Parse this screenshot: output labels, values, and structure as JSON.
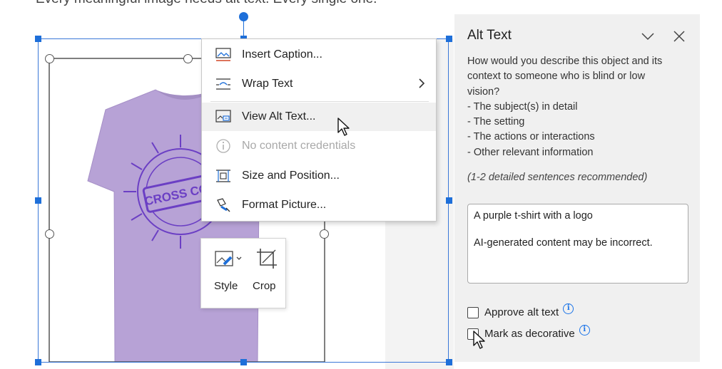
{
  "document": {
    "caption_text": "Every meaningful image needs alt text. Every single one.",
    "image_logo_text": "CROSS COU"
  },
  "context_menu": {
    "items": [
      {
        "label": "Insert Caption...",
        "icon": "insert-caption-icon",
        "state": "normal"
      },
      {
        "label": "Wrap Text",
        "icon": "wrap-text-icon",
        "state": "normal",
        "has_submenu": true
      },
      {
        "label": "View Alt Text...",
        "icon": "alt-text-icon",
        "state": "hover"
      },
      {
        "label": "No content credentials",
        "icon": "info-icon",
        "state": "disabled"
      },
      {
        "label": "Size and Position...",
        "icon": "size-position-icon",
        "state": "normal"
      },
      {
        "label": "Format Picture...",
        "icon": "format-picture-icon",
        "state": "normal"
      }
    ]
  },
  "mini_toolbar": {
    "style_label": "Style",
    "crop_label": "Crop"
  },
  "alt_text_pane": {
    "title": "Alt Text",
    "description_lines": [
      "How would you describe this object and its",
      "context to someone who is blind or low",
      "vision?",
      "- The subject(s) in detail",
      "- The setting",
      "- The actions or interactions",
      "- Other relevant information"
    ],
    "hint": "(1-2 detailed sentences recommended)",
    "alt_text_value": "A purple t-shirt with a logo",
    "ai_notice": "AI-generated content may be incorrect.",
    "approve_label": "Approve alt text",
    "approve_checked": false,
    "decorative_label": "Mark as decorative",
    "decorative_checked": false
  },
  "colors": {
    "accent": "#1e6fd9",
    "shirt": "#b7a2d6",
    "logo": "#6b3fc4",
    "pane_bg": "#f0f0f0",
    "info_blue": "#1a73e8"
  }
}
